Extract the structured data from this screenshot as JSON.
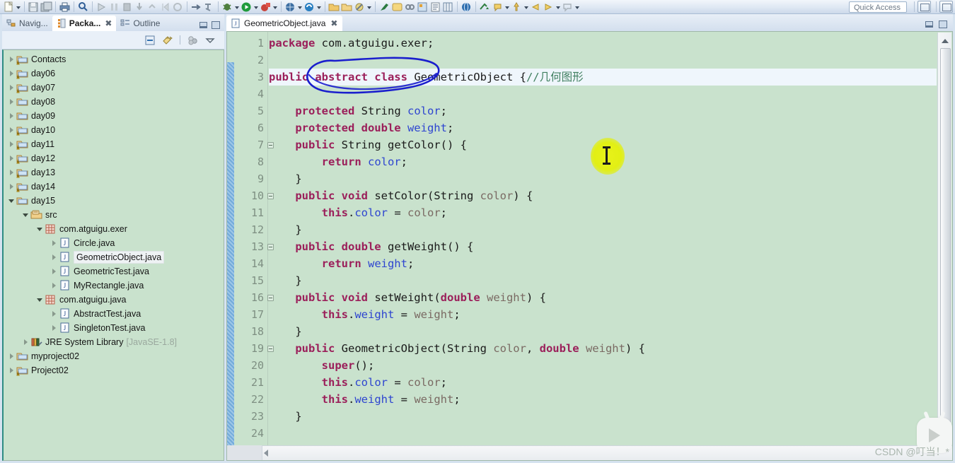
{
  "toolbar": {
    "quick_access_label": "Quick Access",
    "icons": [
      "new-file-icon",
      "save-icon",
      "save-all-icon",
      "print-icon",
      "search-icon",
      "run-last-icon",
      "debug-icon",
      "terminate-icon",
      "step-icon",
      "step-over-icon",
      "step-return-icon",
      "resume-icon",
      "skip-breakpoints-icon",
      "run-icon",
      "debug-run-icon",
      "coverage-icon",
      "external-tools-icon",
      "new-java-project-icon",
      "new-package-icon",
      "new-class-icon",
      "open-type-icon",
      "java-browsing-icon",
      "search-reference-icon",
      "next-annotation-icon",
      "previous-annotation-icon",
      "last-edit-location-icon",
      "back-icon",
      "forward-icon",
      "pin-editor-icon"
    ]
  },
  "left_panel": {
    "tabs": [
      {
        "label": "Navig...",
        "icon": "navigator-icon",
        "active": false,
        "closable": false
      },
      {
        "label": "Packa...",
        "icon": "package-explorer-icon",
        "active": true,
        "closable": true
      },
      {
        "label": "Outline",
        "icon": "outline-icon",
        "active": false,
        "closable": false
      }
    ],
    "view_toolbar_icons": [
      "collapse-all-icon",
      "link-with-editor-icon",
      "view-menu-group-icon",
      "view-menu-icon"
    ],
    "window_buttons": [
      "minimize-icon",
      "maximize-icon"
    ],
    "tree": [
      {
        "label": "Contacts",
        "indent": 0,
        "state": "collapsed",
        "icon": "java-project-warning-icon"
      },
      {
        "label": "day06",
        "indent": 0,
        "state": "collapsed",
        "icon": "java-project-warning-icon"
      },
      {
        "label": "day07",
        "indent": 0,
        "state": "collapsed",
        "icon": "java-project-warning-icon"
      },
      {
        "label": "day08",
        "indent": 0,
        "state": "collapsed",
        "icon": "java-project-icon"
      },
      {
        "label": "day09",
        "indent": 0,
        "state": "collapsed",
        "icon": "java-project-icon"
      },
      {
        "label": "day10",
        "indent": 0,
        "state": "collapsed",
        "icon": "java-project-warning-icon"
      },
      {
        "label": "day11",
        "indent": 0,
        "state": "collapsed",
        "icon": "java-project-warning-icon"
      },
      {
        "label": "day12",
        "indent": 0,
        "state": "collapsed",
        "icon": "java-project-warning-icon"
      },
      {
        "label": "day13",
        "indent": 0,
        "state": "collapsed",
        "icon": "java-project-warning-icon"
      },
      {
        "label": "day14",
        "indent": 0,
        "state": "collapsed",
        "icon": "java-project-warning-icon"
      },
      {
        "label": "day15",
        "indent": 0,
        "state": "expanded",
        "icon": "java-project-icon"
      },
      {
        "label": "src",
        "indent": 1,
        "state": "expanded",
        "icon": "source-folder-icon"
      },
      {
        "label": "com.atguigu.exer",
        "indent": 2,
        "state": "expanded",
        "icon": "package-icon"
      },
      {
        "label": "Circle.java",
        "indent": 3,
        "state": "collapsed",
        "icon": "java-file-icon"
      },
      {
        "label": "GeometricObject.java",
        "indent": 3,
        "state": "collapsed",
        "icon": "java-file-icon",
        "selected": true
      },
      {
        "label": "GeometricTest.java",
        "indent": 3,
        "state": "collapsed",
        "icon": "java-file-icon"
      },
      {
        "label": "MyRectangle.java",
        "indent": 3,
        "state": "collapsed",
        "icon": "java-file-icon"
      },
      {
        "label": "com.atguigu.java",
        "indent": 2,
        "state": "expanded",
        "icon": "package-icon"
      },
      {
        "label": "AbstractTest.java",
        "indent": 3,
        "state": "collapsed",
        "icon": "java-file-icon"
      },
      {
        "label": "SingletonTest.java",
        "indent": 3,
        "state": "collapsed",
        "icon": "java-file-icon"
      },
      {
        "label": "JRE System Library",
        "indent": 1,
        "state": "collapsed",
        "icon": "library-icon",
        "suffix": "[JavaSE-1.8]"
      },
      {
        "label": "myproject02",
        "indent": 0,
        "state": "collapsed",
        "icon": "java-project-icon"
      },
      {
        "label": "Project02",
        "indent": 0,
        "state": "collapsed",
        "icon": "java-project-warning-icon"
      }
    ]
  },
  "editor": {
    "tab": {
      "label": "GeometricObject.java",
      "icon": "java-file-icon",
      "close_glyph": "✖"
    },
    "window_buttons": [
      "minimize-icon",
      "restore-icon"
    ],
    "current_line": 3,
    "fold_lines": [
      7,
      10,
      13,
      16,
      19
    ],
    "lines": [
      {
        "n": 1,
        "tokens": [
          {
            "t": "package ",
            "c": "kw"
          },
          {
            "t": "com.atguigu.exer;",
            "c": "plain"
          }
        ]
      },
      {
        "n": 2,
        "tokens": []
      },
      {
        "n": 3,
        "tokens": [
          {
            "t": "public abstract class ",
            "c": "kw"
          },
          {
            "t": "GeometricObject ",
            "c": "plain"
          },
          {
            "t": "{",
            "c": "plain"
          },
          {
            "t": "//几何图形",
            "c": "cmt"
          }
        ]
      },
      {
        "n": 4,
        "tokens": []
      },
      {
        "n": 5,
        "tokens": [
          {
            "t": "    protected ",
            "c": "kw"
          },
          {
            "t": "String ",
            "c": "plain"
          },
          {
            "t": "color",
            "c": "fld"
          },
          {
            "t": ";",
            "c": "plain"
          }
        ]
      },
      {
        "n": 6,
        "tokens": [
          {
            "t": "    protected double ",
            "c": "kw"
          },
          {
            "t": "weight",
            "c": "fld"
          },
          {
            "t": ";",
            "c": "plain"
          }
        ]
      },
      {
        "n": 7,
        "tokens": [
          {
            "t": "    public ",
            "c": "kw"
          },
          {
            "t": "String ",
            "c": "plain"
          },
          {
            "t": "getColor",
            "c": "plain"
          },
          {
            "t": "() {",
            "c": "plain"
          }
        ]
      },
      {
        "n": 8,
        "tokens": [
          {
            "t": "        return ",
            "c": "kw"
          },
          {
            "t": "color",
            "c": "fld"
          },
          {
            "t": ";",
            "c": "plain"
          }
        ]
      },
      {
        "n": 9,
        "tokens": [
          {
            "t": "    }",
            "c": "plain"
          }
        ]
      },
      {
        "n": 10,
        "tokens": [
          {
            "t": "    public void ",
            "c": "kw"
          },
          {
            "t": "setColor",
            "c": "plain"
          },
          {
            "t": "(String ",
            "c": "plain"
          },
          {
            "t": "color",
            "c": "param"
          },
          {
            "t": ") {",
            "c": "plain"
          }
        ]
      },
      {
        "n": 11,
        "tokens": [
          {
            "t": "        this",
            "c": "kw"
          },
          {
            "t": ".",
            "c": "plain"
          },
          {
            "t": "color",
            "c": "fld"
          },
          {
            "t": " = ",
            "c": "plain"
          },
          {
            "t": "color",
            "c": "param"
          },
          {
            "t": ";",
            "c": "plain"
          }
        ]
      },
      {
        "n": 12,
        "tokens": [
          {
            "t": "    }",
            "c": "plain"
          }
        ]
      },
      {
        "n": 13,
        "tokens": [
          {
            "t": "    public double ",
            "c": "kw"
          },
          {
            "t": "getWeight",
            "c": "plain"
          },
          {
            "t": "() {",
            "c": "plain"
          }
        ]
      },
      {
        "n": 14,
        "tokens": [
          {
            "t": "        return ",
            "c": "kw"
          },
          {
            "t": "weight",
            "c": "fld"
          },
          {
            "t": ";",
            "c": "plain"
          }
        ]
      },
      {
        "n": 15,
        "tokens": [
          {
            "t": "    }",
            "c": "plain"
          }
        ]
      },
      {
        "n": 16,
        "tokens": [
          {
            "t": "    public void ",
            "c": "kw"
          },
          {
            "t": "setWeight",
            "c": "plain"
          },
          {
            "t": "(",
            "c": "plain"
          },
          {
            "t": "double ",
            "c": "kw"
          },
          {
            "t": "weight",
            "c": "param"
          },
          {
            "t": ") {",
            "c": "plain"
          }
        ]
      },
      {
        "n": 17,
        "tokens": [
          {
            "t": "        this",
            "c": "kw"
          },
          {
            "t": ".",
            "c": "plain"
          },
          {
            "t": "weight",
            "c": "fld"
          },
          {
            "t": " = ",
            "c": "plain"
          },
          {
            "t": "weight",
            "c": "param"
          },
          {
            "t": ";",
            "c": "plain"
          }
        ]
      },
      {
        "n": 18,
        "tokens": [
          {
            "t": "    }",
            "c": "plain"
          }
        ]
      },
      {
        "n": 19,
        "tokens": [
          {
            "t": "    public ",
            "c": "kw"
          },
          {
            "t": "GeometricObject",
            "c": "plain"
          },
          {
            "t": "(String ",
            "c": "plain"
          },
          {
            "t": "color",
            "c": "param"
          },
          {
            "t": ", ",
            "c": "plain"
          },
          {
            "t": "double ",
            "c": "kw"
          },
          {
            "t": "weight",
            "c": "param"
          },
          {
            "t": ") {",
            "c": "plain"
          }
        ]
      },
      {
        "n": 20,
        "tokens": [
          {
            "t": "        super",
            "c": "kw"
          },
          {
            "t": "();",
            "c": "plain"
          }
        ]
      },
      {
        "n": 21,
        "tokens": [
          {
            "t": "        this",
            "c": "kw"
          },
          {
            "t": ".",
            "c": "plain"
          },
          {
            "t": "color",
            "c": "fld"
          },
          {
            "t": " = ",
            "c": "plain"
          },
          {
            "t": "color",
            "c": "param"
          },
          {
            "t": ";",
            "c": "plain"
          }
        ]
      },
      {
        "n": 22,
        "tokens": [
          {
            "t": "        this",
            "c": "kw"
          },
          {
            "t": ".",
            "c": "plain"
          },
          {
            "t": "weight",
            "c": "fld"
          },
          {
            "t": " = ",
            "c": "plain"
          },
          {
            "t": "weight",
            "c": "param"
          },
          {
            "t": ";",
            "c": "plain"
          }
        ]
      },
      {
        "n": 23,
        "tokens": [
          {
            "t": "    }",
            "c": "plain"
          }
        ]
      },
      {
        "n": 24,
        "tokens": []
      }
    ]
  },
  "annotation": {
    "kind": "hand-drawn-ellipse",
    "color": "#1a1ecd",
    "target_text": "abstract class"
  },
  "cursor_overlay": {
    "kind": "mouse-highlight",
    "color": "#e2ef14",
    "pointer": "text-ibeam"
  },
  "watermark": {
    "text": "CSDN @叮当！*",
    "logo": "video-play-icon"
  },
  "colors": {
    "editor_background": "#c9e2cd",
    "current_line": "#eff6fc",
    "keyword": "#9b1f5a",
    "field": "#2e45d0",
    "comment": "#3f7f5f",
    "annotation_blue": "#1a1ecd",
    "highlight_yellow": "#e2ef14",
    "panel_border_teal": "#2e8b83"
  }
}
